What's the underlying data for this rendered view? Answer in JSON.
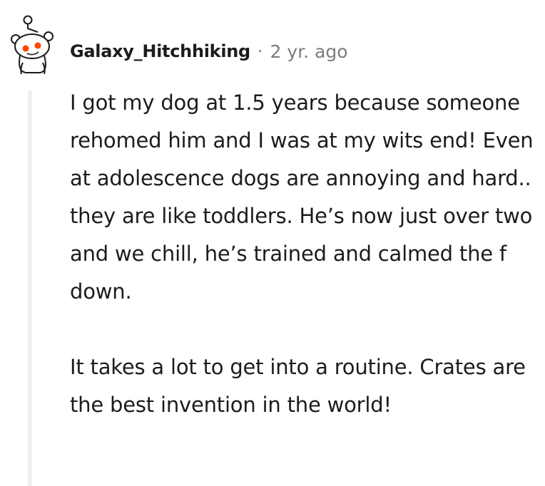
{
  "comment": {
    "username": "Galaxy_Hitchhiking",
    "separator": "·",
    "timestamp": "2 yr. ago",
    "avatar_icon": "snoo-avatar-icon",
    "paragraphs": [
      "I got my dog at 1.5 years because someone rehomed him and I was at my wits end! Even at adolescence dogs are annoying and hard.. they are like toddlers. He’s now just over two and we chill, he’s trained and calmed the f down.",
      "It takes a lot to get into a routine. Crates are the best invention in the world!"
    ]
  },
  "colors": {
    "text": "#1c1c1c",
    "meta": "#7c7c7c",
    "thread_line": "#edeff1",
    "snoo_orange": "#ff4500"
  }
}
